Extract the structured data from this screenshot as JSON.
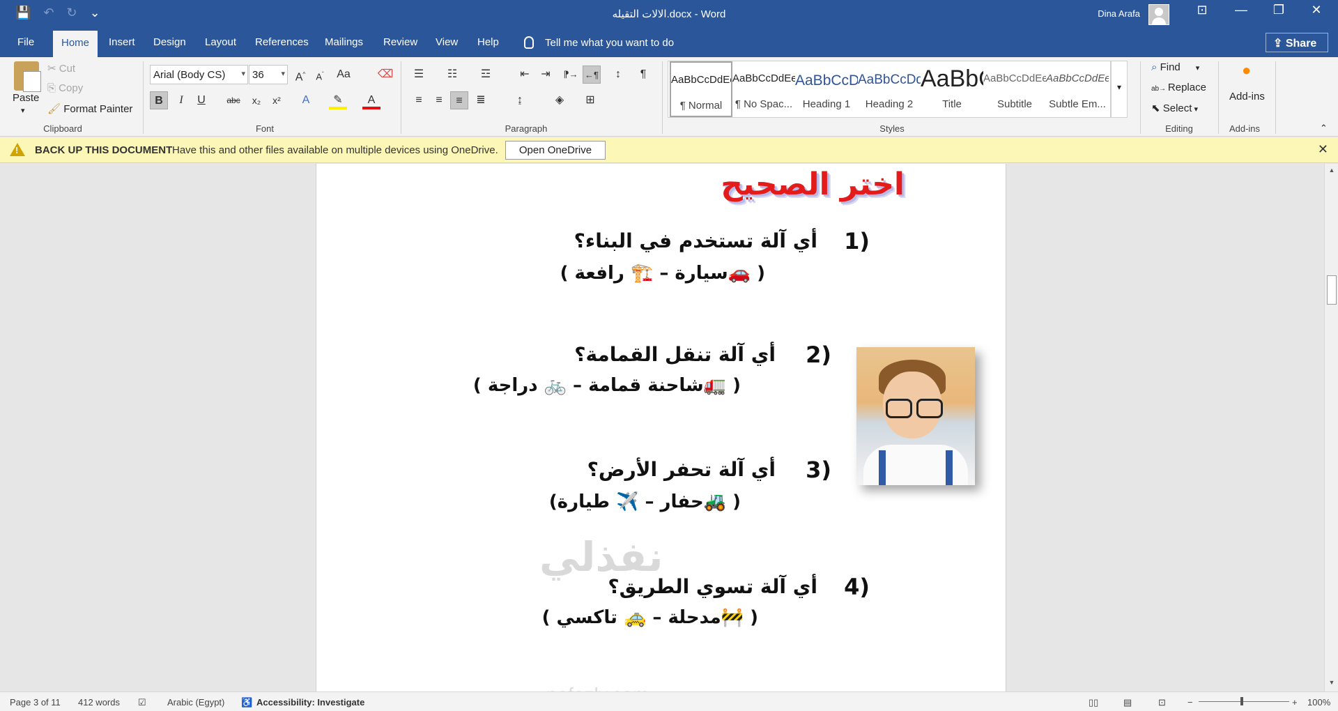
{
  "window": {
    "title": "الالات التقيله.docx  -  Word",
    "user": "Dina Arafa",
    "minimize": "—",
    "restore": "❐",
    "close": "✕",
    "ribbon_options": "⊡"
  },
  "qat": {
    "save": "💾",
    "undo": "↶",
    "redo": "↻",
    "customize": "⌄"
  },
  "tabs": [
    "File",
    "Home",
    "Insert",
    "Design",
    "Layout",
    "References",
    "Mailings",
    "Review",
    "View",
    "Help"
  ],
  "tell_me": "Tell me what you want to do",
  "share": "Share",
  "clipboard": {
    "paste": "Paste",
    "cut": "Cut",
    "copy": "Copy",
    "format_painter": "Format Painter",
    "label": "Clipboard"
  },
  "font": {
    "name": "Arial (Body CS)",
    "size": "36",
    "label": "Font",
    "bold": "B",
    "italic": "I",
    "underline": "U",
    "strike": "abc",
    "sub": "x₂",
    "sup": "x²"
  },
  "paragraph": {
    "label": "Paragraph",
    "pilcrow": "¶"
  },
  "styles": {
    "label": "Styles",
    "items": [
      {
        "preview": "AaBbCcDdEe",
        "name": "¶ Normal"
      },
      {
        "preview": "AaBbCcDdEe",
        "name": "¶ No Spac..."
      },
      {
        "preview": "AaBbCcDdEe",
        "name": "Heading 1"
      },
      {
        "preview": "AaBbCcDdEe",
        "name": "Heading 2"
      },
      {
        "preview": "AaBbCcDdEe",
        "name": "Title"
      },
      {
        "preview": "AaBbCcDdEe",
        "name": "Subtitle"
      },
      {
        "preview": "AaBbCcDdEe",
        "name": "Subtle Em..."
      }
    ]
  },
  "editing": {
    "find": "Find",
    "replace": "Replace",
    "select": "Select",
    "label": "Editing"
  },
  "addins": {
    "button": "Add-ins",
    "label": "Add-ins"
  },
  "message_bar": {
    "title": "BACK UP THIS DOCUMENT",
    "text": "Have this and other files available on multiple devices using OneDrive.",
    "button": "Open OneDrive"
  },
  "document": {
    "heading": "اختر الصحيح",
    "questions": [
      {
        "num": "1)",
        "text": "أي آلة تستخدم في البناء؟",
        "options": "( 🚗سيارة – 🏗️ رافعة )"
      },
      {
        "num": "2)",
        "text": "أي آلة تنقل القمامة؟",
        "options": "( 🚛شاحنة قمامة – 🚲 دراجة )"
      },
      {
        "num": "3)",
        "text": "أي آلة تحفر الأرض؟",
        "options": "( 🚜حفار – ✈️ طيارة)"
      },
      {
        "num": "4)",
        "text": "أي آلة تسوي الطريق؟",
        "options": "( 🚧مدحلة – 🚕 تاكسي )"
      }
    ],
    "watermark": "نفذلي",
    "watermark_url": "nafezly.com"
  },
  "status": {
    "page": "Page 3 of 11",
    "words": "412 words",
    "language": "Arabic (Egypt)",
    "accessibility": "Accessibility: Investigate",
    "zoom": "100%"
  }
}
